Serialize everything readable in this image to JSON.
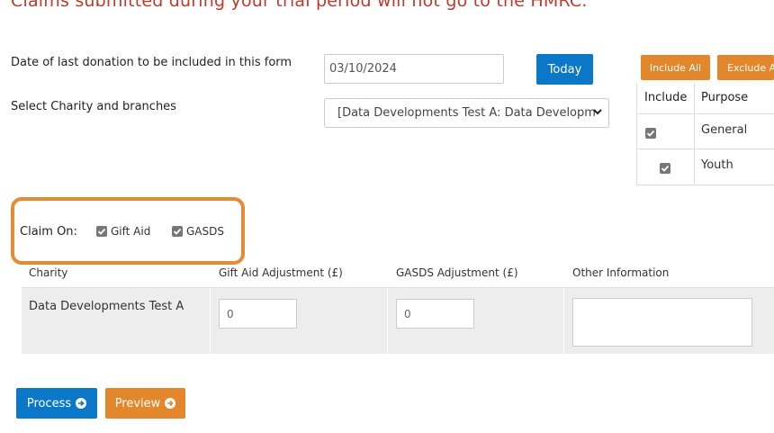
{
  "warning": {
    "text": "Claims submitted during your trial period will not go to the HMRC."
  },
  "form": {
    "date_label": "Date of last donation to be included in this form",
    "date_value": "03/10/2024",
    "today_button": "Today",
    "charity_label": "Select Charity and branches",
    "charity_selected": "[Data Developments Test A: Data Developm",
    "include_all_button": "Include All",
    "exclude_all_button": "Exclude A"
  },
  "purposes": {
    "header_include": "Include",
    "header_purpose": "Purpose",
    "rows": [
      {
        "purpose": "General",
        "included": true
      },
      {
        "purpose": "Youth",
        "included": true
      }
    ]
  },
  "claim_on": {
    "label": "Claim On:",
    "options": [
      {
        "label": "Gift Aid",
        "checked": true
      },
      {
        "label": "GASDS",
        "checked": true
      }
    ],
    "highlight_color": "#e58a35"
  },
  "grid": {
    "headers": [
      "Charity",
      "Gift Aid Adjustment (£)",
      "GASDS Adjustment (£)",
      "Other Information"
    ],
    "rows": [
      {
        "charity": "Data Developments Test A",
        "gift_aid_adjustment": "0",
        "gasds_adjustment": "0",
        "other_information": ""
      }
    ]
  },
  "actions": {
    "process_button": "Process",
    "preview_button": "Preview"
  },
  "colors": {
    "warning": "#c0392b",
    "primary": "#0a77c7",
    "secondary": "#e2872b"
  }
}
